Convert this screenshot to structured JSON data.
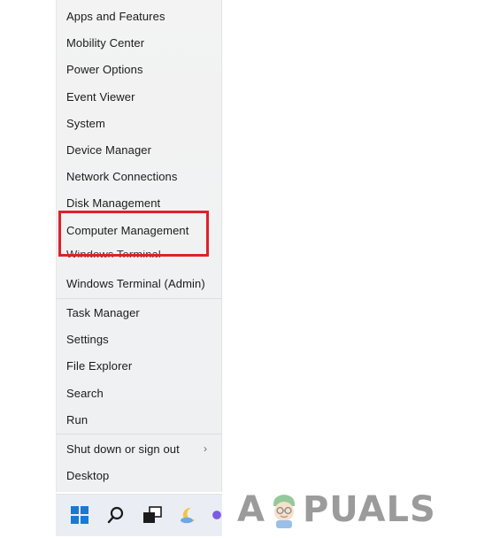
{
  "menu": {
    "items": [
      {
        "label": "Apps and Features"
      },
      {
        "label": "Mobility Center"
      },
      {
        "label": "Power Options"
      },
      {
        "label": "Event Viewer"
      },
      {
        "label": "System"
      },
      {
        "label": "Device Manager"
      },
      {
        "label": "Network Connections"
      },
      {
        "label": "Disk Management"
      },
      {
        "label": "Computer Management"
      },
      {
        "label": "Windows Terminal"
      },
      {
        "label": "Windows Terminal (Admin)"
      },
      {
        "label": "Task Manager"
      },
      {
        "label": "Settings"
      },
      {
        "label": "File Explorer"
      },
      {
        "label": "Search"
      },
      {
        "label": "Run"
      },
      {
        "label": "Shut down or sign out"
      },
      {
        "label": "Desktop"
      }
    ],
    "submenu_chevron": "›"
  },
  "highlight": {
    "color": "#e0202b",
    "target": "Computer Management"
  },
  "taskbar": {
    "icons": [
      "windows-start-icon",
      "search-icon",
      "task-view-icon",
      "widgets-icon",
      "chat-icon"
    ]
  },
  "watermark": {
    "text_left": "A",
    "text_right": "PUALS"
  }
}
